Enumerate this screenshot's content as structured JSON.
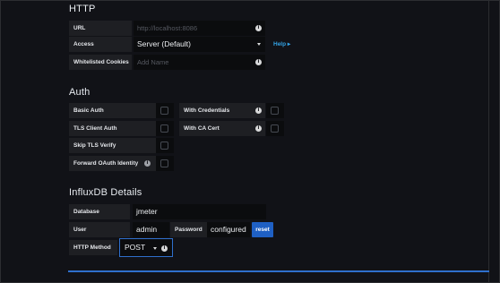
{
  "http": {
    "title": "HTTP",
    "url": {
      "label": "URL",
      "placeholder": "http://localhost:8086"
    },
    "access": {
      "label": "Access",
      "value": "Server (Default)",
      "help": "Help ▸"
    },
    "cookies": {
      "label": "Whitelisted Cookies",
      "placeholder": "Add Name"
    }
  },
  "auth": {
    "title": "Auth",
    "basic_auth": "Basic Auth",
    "with_credentials": "With Credentials",
    "tls_client_auth": "TLS Client Auth",
    "with_ca_cert": "With CA Cert",
    "skip_tls_verify": "Skip TLS Verify",
    "forward_oauth": "Forward OAuth Identity"
  },
  "influx": {
    "title": "InfluxDB Details",
    "database": {
      "label": "Database",
      "value": "jmeter"
    },
    "user": {
      "label": "User",
      "value": "admin"
    },
    "password": {
      "label": "Password",
      "value": "configured",
      "reset": "reset"
    },
    "http_method": {
      "label": "HTTP Method",
      "value": "POST"
    }
  },
  "icons": {
    "info": "info-icon",
    "caret": "chevron-down-icon"
  },
  "colors": {
    "background": "#111217",
    "accent": "#1f60c4",
    "link": "#33a2e5"
  }
}
